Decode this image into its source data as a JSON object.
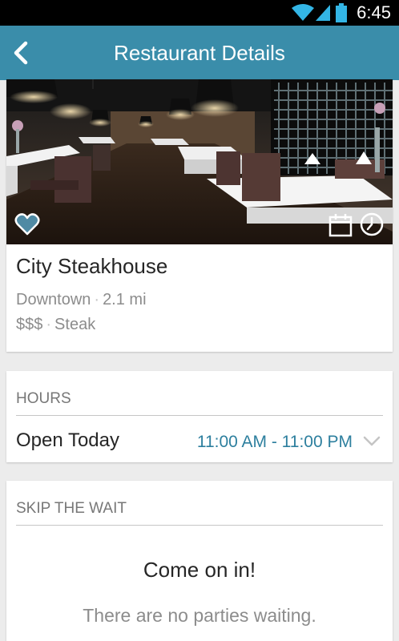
{
  "status_bar": {
    "time": "6:45"
  },
  "app_bar": {
    "title": "Restaurant Details"
  },
  "restaurant": {
    "name": "City Steakhouse",
    "neighborhood": "Downtown",
    "distance": "2.1 mi",
    "price": "$$$",
    "cuisine": "Steak",
    "separator": "·",
    "favorited": false
  },
  "hours": {
    "heading": "HOURS",
    "label": "Open Today",
    "value": "11:00 AM - 11:00 PM"
  },
  "wait": {
    "heading": "SKIP THE WAIT",
    "headline": "Come on in!",
    "message": "There are no parties waiting."
  },
  "icons": {
    "back": "chevron-left-icon",
    "favorite": "heart-outline-icon",
    "calendar": "calendar-icon",
    "clock": "clock-icon",
    "expand": "chevron-down-icon",
    "wifi": "wifi-icon",
    "signal": "signal-icon",
    "battery": "battery-icon"
  },
  "colors": {
    "accent": "#3a8daa",
    "link": "#2d7f9e",
    "status_icons": "#33b5e5"
  }
}
